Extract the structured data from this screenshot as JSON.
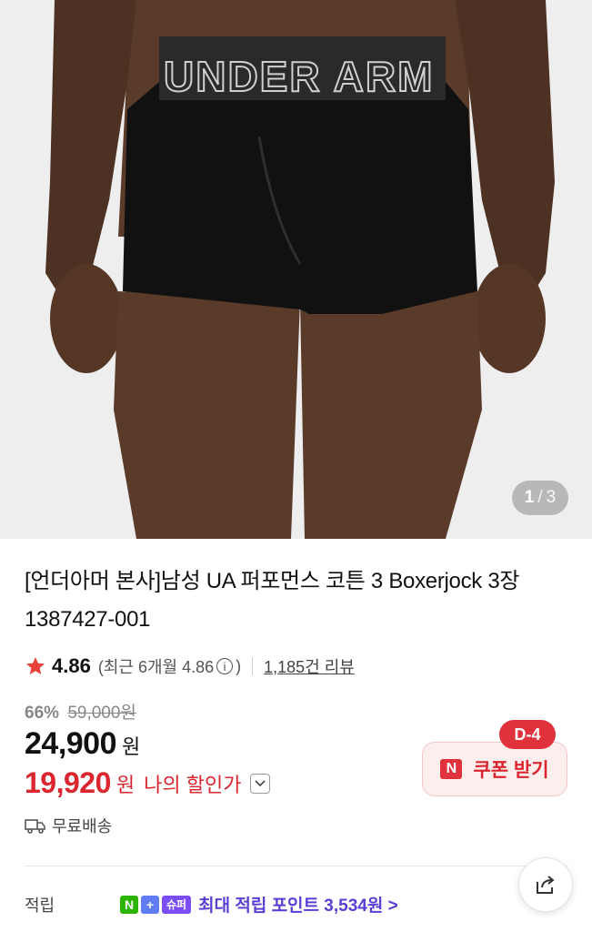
{
  "gallery": {
    "current": "1",
    "separator": "/",
    "total": "3",
    "waistband_text": "UNDER ARM"
  },
  "product": {
    "title": "[언더아머 본사]남성 UA 퍼포먼스 코튼 3 Boxerjock 3장 1387427-001"
  },
  "rating": {
    "value": "4.86",
    "recent_label": "(최근 6개월 4.86",
    "info_icon": "i",
    "close_paren": ")",
    "reviews": "1,185건 리뷰"
  },
  "pricing": {
    "discount_rate": "66%",
    "original_price": "59,000원",
    "price": "24,900",
    "price_unit": "원",
    "my_price": "19,920",
    "my_price_unit": "원",
    "my_price_label": "나의 할인가"
  },
  "coupon": {
    "badge": "D-4",
    "logo": "N",
    "label": "쿠폰 받기"
  },
  "shipping": {
    "label": "무료배송"
  },
  "points": {
    "label": "적립",
    "np_n": "N",
    "np_plus": "+",
    "super_badge": "슈퍼",
    "text": "최대 적립 포인트 3,534원 >"
  },
  "colors": {
    "accent_red": "#d9262f",
    "points_purple": "#5b3ed6"
  },
  "icons": [
    "star-icon",
    "info-icon",
    "chevron-down-icon",
    "n-pay-logo-icon",
    "truck-icon",
    "share-icon"
  ]
}
